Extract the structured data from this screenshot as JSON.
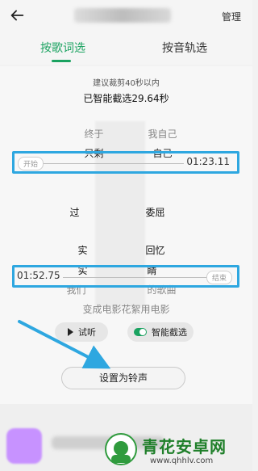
{
  "topbar": {
    "manage_label": "管理"
  },
  "tabs": [
    {
      "label": "按歌词选",
      "active": true
    },
    {
      "label": "按音轨选",
      "active": false
    }
  ],
  "crop": {
    "hint": "建议裁剪40秒以内",
    "selected": "已智能截选29.64秒",
    "start_pill": "开始",
    "start_time": "01:23.11",
    "end_time": "01:52.75",
    "end_pill": "结束"
  },
  "lyrics": [
    "终于",
    "我自己",
    "只剩",
    "自己",
    "过",
    "委屈",
    "实",
    "回忆",
    "实",
    "睛",
    "我们",
    "的歌曲",
    "变成电影花絮用电影"
  ],
  "controls": {
    "listen_label": "试听",
    "smart_label": "智能截选"
  },
  "action": {
    "set_ringtone_label": "设置为铃声"
  },
  "watermark": {
    "site_name": "青花安卓网",
    "site_url": "www.qhhlv.com"
  },
  "colors": {
    "accent_green": "#1aa260",
    "annotation_blue": "#2ea7e0"
  }
}
